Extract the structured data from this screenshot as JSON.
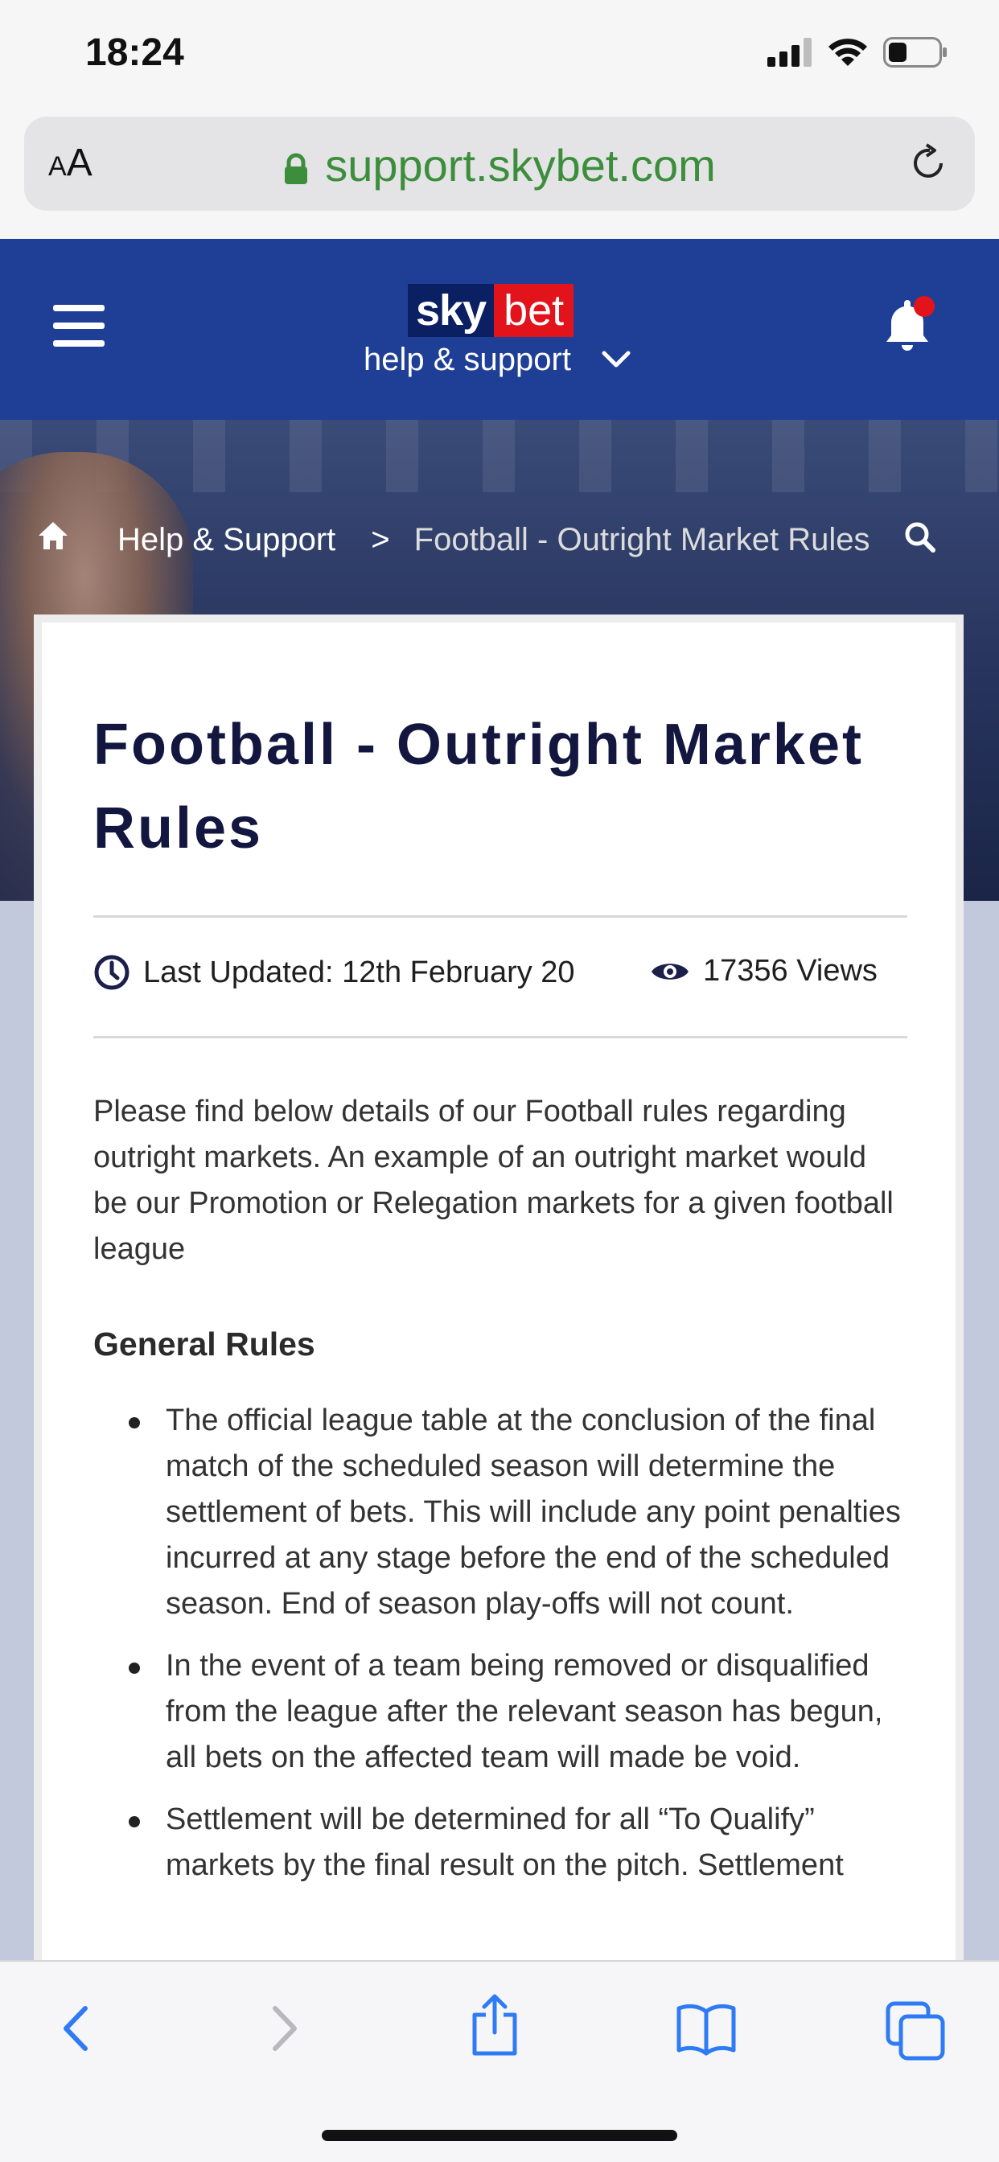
{
  "status_bar": {
    "time": "18:24"
  },
  "browser": {
    "text_size_label": "AA",
    "url": "support.skybet.com"
  },
  "header": {
    "logo_sky": "sky",
    "logo_bet": "bet",
    "subtitle": "help & support"
  },
  "breadcrumb": {
    "home": "home",
    "crumb1": "Help & Support",
    "separator": ">",
    "current": "Football - Outright Market Rules"
  },
  "article": {
    "title": "Football - Outright Market Rules",
    "last_updated": "Last Updated: 12th February 20",
    "views": "17356 Views",
    "intro": "Please find below details of our Football rules regarding outright markets. An example of an outright market would be our Promotion or Relegation markets for a given football league",
    "section_heading": "General Rules",
    "rules": [
      "The official league table at the conclusion of the final match of the scheduled season will determine the settlement of bets. This will include any point penalties incurred at any stage before the end of the scheduled season. End of season play-offs will not count.",
      "In the event of a team being removed or disqualified from the league after the relevant season has begun, all bets on the affected team will made be void.",
      "Settlement will be determined for all “To Qualify” markets by the final result on the pitch. Settlement"
    ]
  },
  "colors": {
    "header_blue": "#1f3f97",
    "url_green": "#3c8e3c",
    "logo_red": "#e3131b",
    "notification_red": "#e3131b",
    "toolbar_blue": "#2f7bf5"
  },
  "icons": {
    "hamburger": "hamburger-menu-icon",
    "bell": "notification-bell-icon",
    "home": "home-icon",
    "search": "search-icon",
    "clock": "clock-icon",
    "eye": "eye-icon",
    "lock": "lock-icon",
    "reload": "reload-icon",
    "back": "back-icon",
    "forward": "forward-icon",
    "share": "share-icon",
    "bookmarks": "bookmarks-icon",
    "tabs": "tabs-icon"
  }
}
